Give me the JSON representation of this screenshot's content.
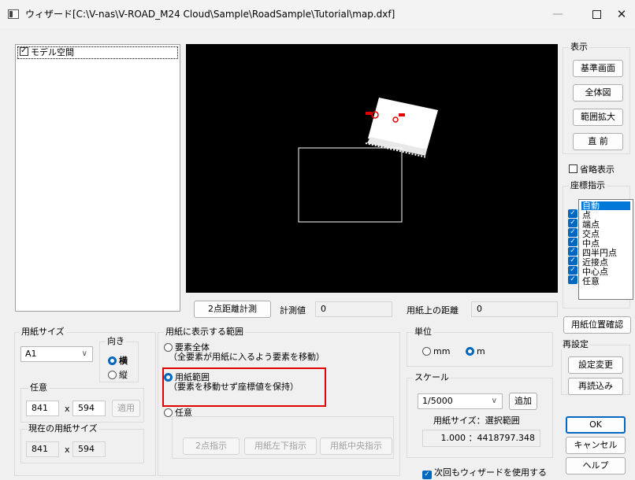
{
  "window": {
    "title": "ウィザード[C:\\V-nas\\V-ROAD_M24 Cloud\\Sample\\RoadSample\\Tutorial\\map.dxf]",
    "min_glyph": "—",
    "close_glyph": "✕"
  },
  "tree": {
    "item_label": "モデル空間",
    "checked": true
  },
  "view": {
    "section_label": "表示",
    "buttons": [
      "基準画面",
      "全体図",
      "範囲拡大",
      "直 前"
    ],
    "omit_label": "省略表示"
  },
  "coord": {
    "section_label": "座標指示",
    "items": [
      "自動",
      "点",
      "端点",
      "交点",
      "中点",
      "四半円点",
      "近接点",
      "中心点",
      "任意"
    ]
  },
  "measure": {
    "button": "2点距離計測",
    "value_label": "計測値",
    "value": "0",
    "paper_label": "用紙上の距離",
    "paper_value": "0"
  },
  "paper": {
    "section_label": "用紙サイズ",
    "size": "A1",
    "orientation_label": "向き",
    "landscape": "横",
    "portrait": "縦",
    "custom_label": "任意",
    "width": "841",
    "x": "x",
    "height": "594",
    "apply": "適用",
    "current_label": "現在の用紙サイズ",
    "current_width": "841",
    "current_height": "594"
  },
  "range": {
    "section_label": "用紙に表示する範囲",
    "opt1_title": "要素全体",
    "opt1_desc": "（全要素が用紙に入るよう要素を移動）",
    "opt2_title": "用紙範囲",
    "opt2_desc": "（要素を移動せず座標値を保持）",
    "opt3_title": "任意",
    "btn_2pt": "2点指示",
    "btn_lr": "用紙左下指示",
    "btn_center": "用紙中央指示"
  },
  "unit": {
    "section_label": "単位",
    "mm": "mm",
    "m": "m"
  },
  "scale": {
    "section_label": "スケール",
    "value": "1/5000",
    "add": "追加",
    "size_label": "用紙サイズ：選択範囲",
    "ratio": "1.000 ：4418797.348"
  },
  "right": {
    "paper_position": "用紙位置確認",
    "reset_label": "再設定",
    "change": "設定変更",
    "reload": "再読込み",
    "ok": "OK",
    "cancel": "キャンセル",
    "help": "ヘルプ"
  },
  "footer": {
    "use_next": "次回もウィザードを使用する",
    "checked": true
  },
  "colors": {
    "accent": "#0067c0",
    "highlight": "#e00000",
    "canvas": "#000000"
  }
}
